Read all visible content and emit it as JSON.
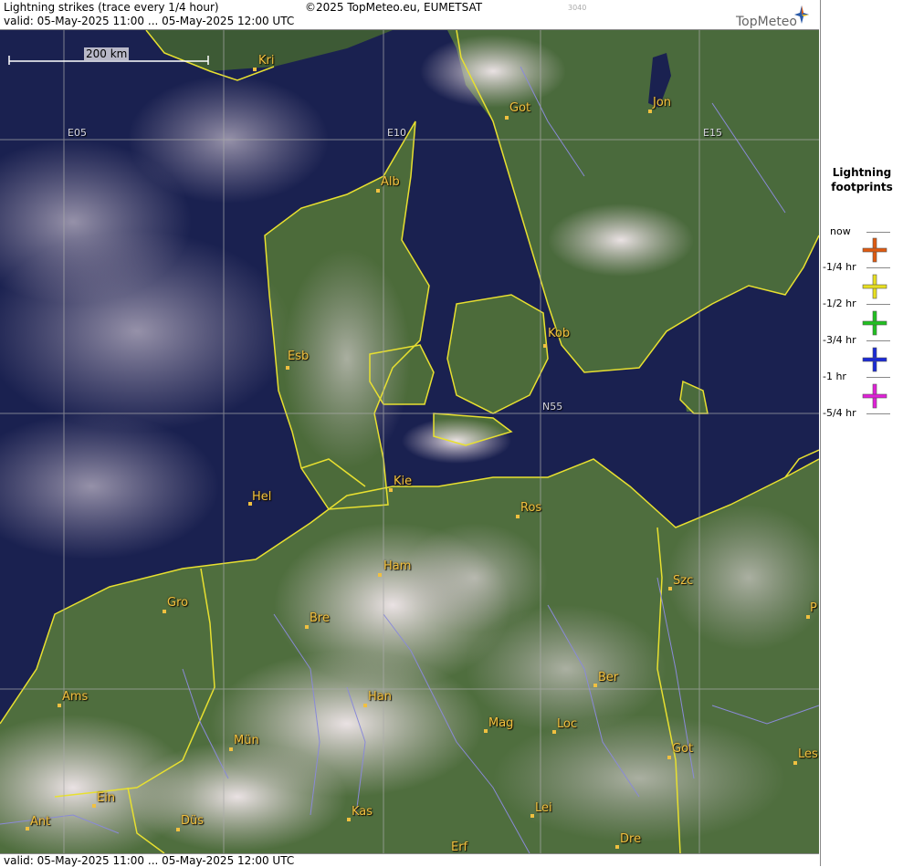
{
  "header": {
    "title": "Lightning strikes (trace every 1/4 hour)",
    "copyright": "©2025 TopMeteo.eu, EUMETSAT",
    "code": "3040",
    "valid": "valid:  05-May-2025 11:00 ... 05-May-2025 12:00 UTC",
    "brand": "TopMeteo"
  },
  "map": {
    "scale_label": "200 km",
    "grid_labels": [
      "E05",
      "E10",
      "E15",
      "N55"
    ],
    "cities": [
      "Kri",
      "Got",
      "Jon",
      "Alb",
      "Kob",
      "Esb",
      "Kie",
      "Hel",
      "Ros",
      "Ham",
      "Szc",
      "Gro",
      "Bre",
      "Ber",
      "Ams",
      "Han",
      "Mag",
      "Loc",
      "Mün",
      "Got",
      "Les",
      "Ein",
      "Kas",
      "Lei",
      "Ant",
      "Düs",
      "Erf",
      "Dre",
      "P"
    ]
  },
  "legend": {
    "title": "Lightning footprints",
    "levels": [
      "now",
      "-1/4 hr",
      "-1/2 hr",
      "-3/4 hr",
      "-1 hr",
      "-5/4 hr"
    ],
    "colors": [
      "#e05a10",
      "#e8e020",
      "#20c020",
      "#1a2ad8",
      "#e020d8"
    ]
  },
  "footer": {
    "valid": "valid:  05-May-2025 11:00 ... 05-May-2025 12:00 UTC"
  }
}
